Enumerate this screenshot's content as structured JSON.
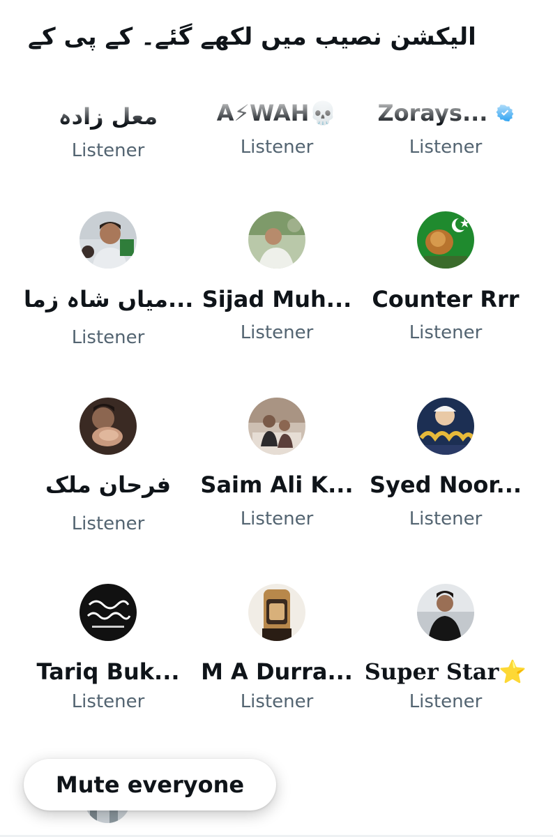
{
  "space": {
    "title": "الیکشن نصیب میں لکھے گئے۔ کے پی کے"
  },
  "listeners": [
    {
      "name": "معل زادہ",
      "role": "Listener",
      "avatar": "none"
    },
    {
      "name": "A⚡WAH💀",
      "role": "Listener",
      "avatar": "none"
    },
    {
      "name": "Zorays...",
      "role": "Listener",
      "avatar": "none",
      "verified": true
    },
    {
      "name": "میاں شاہ زما...",
      "role": "Listener",
      "avatar": "man-photo-avatar"
    },
    {
      "name": "Sijad Muh...",
      "role": "Listener",
      "avatar": "outdoor-photo-avatar"
    },
    {
      "name": "Counter Rrr",
      "role": "Listener",
      "avatar": "lion-flag-avatar"
    },
    {
      "name": "فرحان ملک",
      "role": "Listener",
      "avatar": "hands-photo-avatar"
    },
    {
      "name": "Saim Ali K...",
      "role": "Listener",
      "avatar": "couple-photo-avatar"
    },
    {
      "name": "Syed Noor...",
      "role": "Listener",
      "avatar": "calligraphy-logo-avatar"
    },
    {
      "name": "Tariq Buk...",
      "role": "Listener",
      "avatar": "arabic-text-avatar"
    },
    {
      "name": "M A Durra...",
      "role": "Listener",
      "avatar": "watch-photo-avatar"
    },
    {
      "name": "Super Star⭐",
      "role": "Listener",
      "avatar": "man-black-shirt-avatar"
    }
  ],
  "actions": {
    "mute_label": "Mute everyone"
  },
  "colors": {
    "text": "#0f1419",
    "secondary": "#536471",
    "verified": "#1d9bf0"
  }
}
